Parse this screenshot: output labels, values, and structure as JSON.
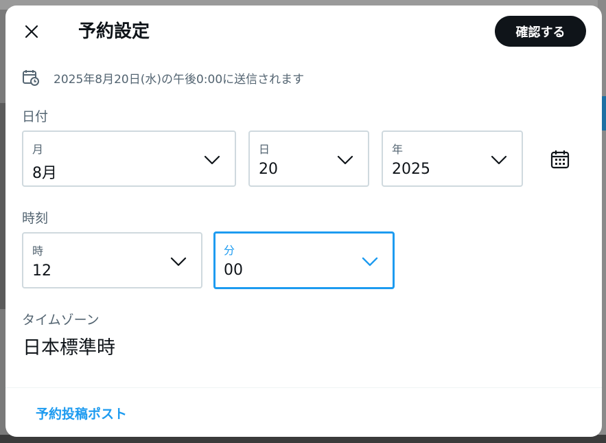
{
  "header": {
    "title": "予約設定",
    "confirm_label": "確認する"
  },
  "schedule_info": "2025年8月20日(水)の午後0:00に送信されます",
  "date_section": {
    "label": "日付",
    "month": {
      "label": "月",
      "value": "8月"
    },
    "day": {
      "label": "日",
      "value": "20"
    },
    "year": {
      "label": "年",
      "value": "2025"
    }
  },
  "time_section": {
    "label": "時刻",
    "hour": {
      "label": "時",
      "value": "12"
    },
    "minute": {
      "label": "分",
      "value": "00"
    }
  },
  "timezone": {
    "label": "タイムゾーン",
    "value": "日本標準時"
  },
  "footer": {
    "scheduled_posts_link": "予約投稿ポスト"
  },
  "colors": {
    "accent": "#1d9bf0",
    "text_primary": "#0f1419",
    "text_secondary": "#536471",
    "border": "#cfd9de"
  },
  "icons": [
    "close-icon",
    "calendar-clock-icon",
    "chevron-down-icon",
    "calendar-icon"
  ]
}
